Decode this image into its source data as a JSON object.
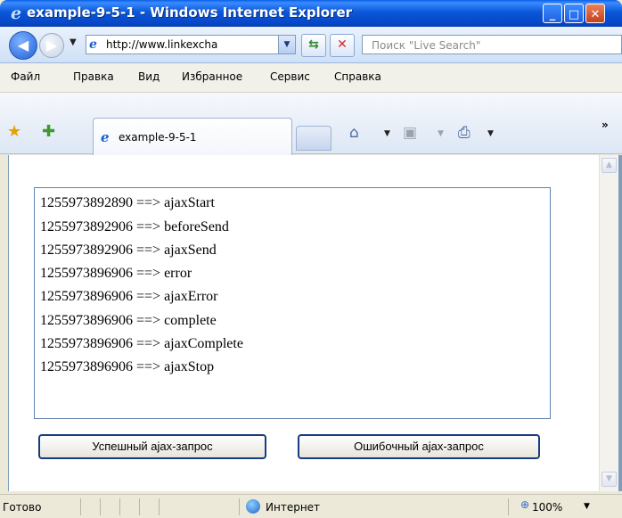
{
  "window": {
    "title": "example-9-5-1 - Windows Internet Explorer",
    "min_label": "_",
    "max_label": "□",
    "close_label": "✕"
  },
  "address_bar": {
    "back_label": "◀",
    "forward_label": "▶",
    "url": "http://www.linkexcha",
    "refresh_label": "⇆",
    "stop_label": "✕",
    "search_placeholder": "Поиск \"Live Search\""
  },
  "menu": {
    "items": [
      "Файл",
      "Правка",
      "Вид",
      "Избранное",
      "Сервис",
      "Справка"
    ]
  },
  "tabs": {
    "active_tab_label": "example-9-5-1",
    "favorites_icon": "star-icon",
    "add_favorites_icon": "add-favorite-icon",
    "home_icon": "home-icon",
    "feeds_icon": "rss-icon",
    "print_icon": "print-icon",
    "more_label": "»"
  },
  "log": {
    "lines": [
      "1255973892890 ==> ajaxStart",
      "1255973892906 ==> beforeSend",
      "1255973892906 ==> ajaxSend",
      "1255973896906 ==> error",
      "1255973896906 ==> ajaxError",
      "1255973896906 ==> complete",
      "1255973896906 ==> ajaxComplete",
      "1255973896906 ==> ajaxStop"
    ]
  },
  "buttons": {
    "success_label": "Успешный ajax-запрос",
    "error_label": "Ошибочный ajax-запрос"
  },
  "status": {
    "text": "Готово",
    "zone": "Интернет",
    "zoom": "100%"
  }
}
